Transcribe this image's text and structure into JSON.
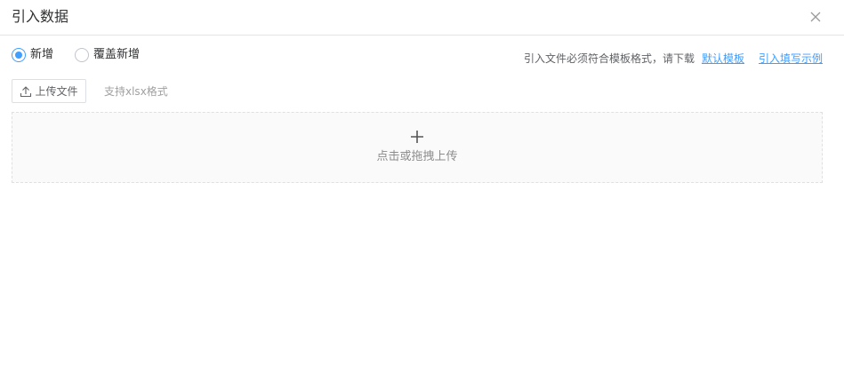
{
  "dialog": {
    "title": "引入数据",
    "close_icon": "close-icon"
  },
  "mode": {
    "options": [
      {
        "label": "新增",
        "checked": true
      },
      {
        "label": "覆盖新增",
        "checked": false
      }
    ]
  },
  "tip": {
    "text": "引入文件必须符合模板格式，请下载",
    "default_template_link": "默认模板",
    "example_link": "引入填写示例"
  },
  "upload": {
    "button_label": "上传文件",
    "button_icon": "upload-icon",
    "hint": "支持xlsx格式"
  },
  "dropzone": {
    "icon": "plus-icon",
    "text": "点击或拖拽上传"
  },
  "colors": {
    "accent": "#409eff",
    "border": "#dcdfe6",
    "dropzone_bg": "#fafafa"
  }
}
